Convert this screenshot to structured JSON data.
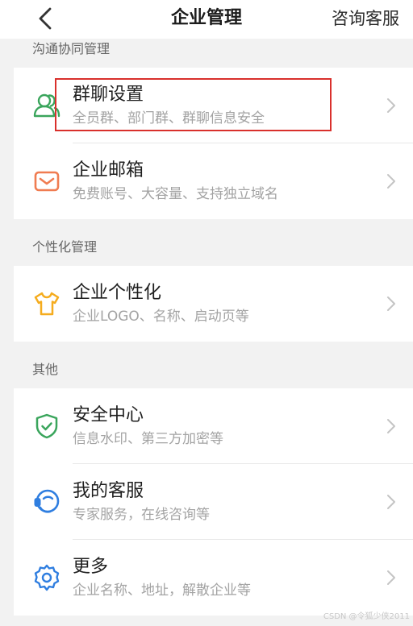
{
  "header": {
    "back_icon": "chevron-left-icon",
    "title": "企业管理",
    "action_label": "咨询客服"
  },
  "sections": [
    {
      "label": "沟通协同管理",
      "items": [
        {
          "title": "群聊设置",
          "subtitle": "全员群、部门群、群聊信息安全",
          "icon": "group-chat-icon",
          "icon_color": "#3aa55c",
          "highlighted": true
        },
        {
          "title": "企业邮箱",
          "subtitle": "免费账号、大容量、支持独立域名",
          "icon": "mail-icon",
          "icon_color": "#f07c51"
        }
      ]
    },
    {
      "label": "个性化管理",
      "items": [
        {
          "title": "企业个性化",
          "subtitle": "企业LOGO、名称、启动页等",
          "icon": "tshirt-icon",
          "icon_color": "#f5ac1e"
        }
      ]
    },
    {
      "label": "其他",
      "items": [
        {
          "title": "安全中心",
          "subtitle": "信息水印、第三方加密等",
          "icon": "shield-check-icon",
          "icon_color": "#3aa55c"
        },
        {
          "title": "我的客服",
          "subtitle": "专家服务，在线咨询等",
          "icon": "customer-service-icon",
          "icon_color": "#2f7ee0"
        },
        {
          "title": "更多",
          "subtitle": "企业名称、地址，解散企业等",
          "icon": "gear-icon",
          "icon_color": "#2f7ee0"
        }
      ]
    }
  ],
  "watermark": "CSDN @令狐少侠2011",
  "colors": {
    "highlight_border": "#d9302c",
    "background": "#f2f2f2",
    "chevron": "#c4c4c4"
  }
}
